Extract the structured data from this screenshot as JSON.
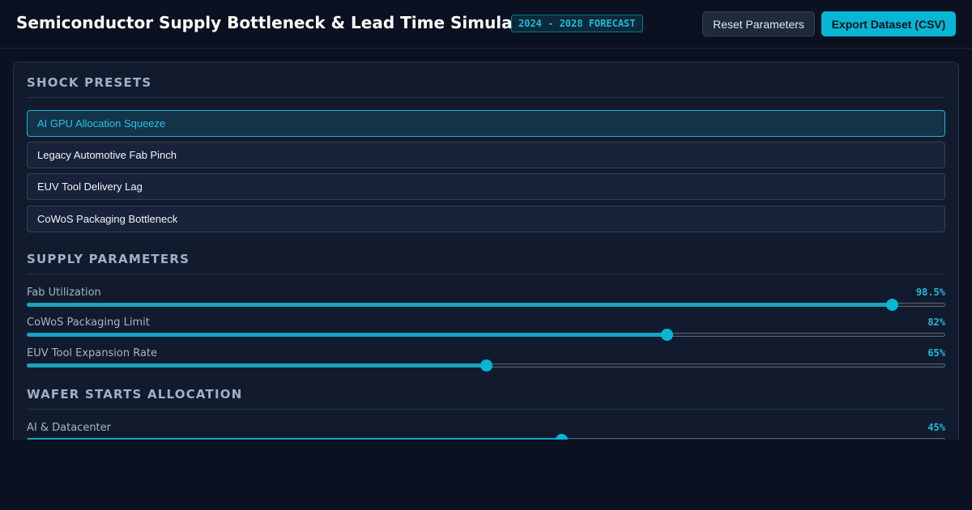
{
  "header": {
    "title": "Semiconductor Supply Bottleneck & Lead Time Simulator",
    "forecast_badge": "2024 - 2028 FORECAST",
    "reset_label": "Reset Parameters",
    "export_label": "Export Dataset (CSV)"
  },
  "colors": {
    "accent": "#06b6d4",
    "background": "#0b1120",
    "panel": "#121b2e"
  },
  "shock_presets": {
    "title": "SHOCK PRESETS",
    "items": [
      {
        "label": "AI GPU Allocation Squeeze",
        "active": true
      },
      {
        "label": "Legacy Automotive Fab Pinch",
        "active": false
      },
      {
        "label": "EUV Tool Delivery Lag",
        "active": false
      },
      {
        "label": "CoWoS Packaging Bottleneck",
        "active": false
      }
    ]
  },
  "supply_parameters": {
    "title": "SUPPLY PARAMETERS",
    "sliders": [
      {
        "label": "Fab Utilization",
        "value_text": "98.5%",
        "fraction": 0.943
      },
      {
        "label": "CoWoS Packaging Limit",
        "value_text": "82%",
        "fraction": 0.697
      },
      {
        "label": "EUV Tool Expansion Rate",
        "value_text": "65%",
        "fraction": 0.5
      }
    ]
  },
  "wafer_allocation": {
    "title": "WAFER STARTS ALLOCATION",
    "sliders": [
      {
        "label": "AI & Datacenter",
        "value_text": "45%",
        "fraction": 0.582
      }
    ]
  }
}
